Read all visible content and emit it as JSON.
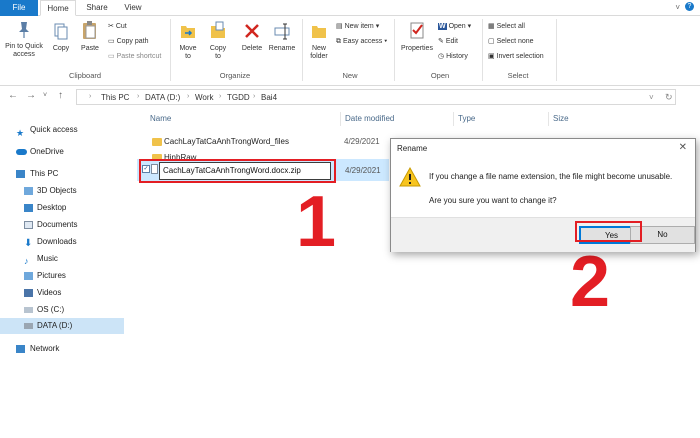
{
  "tabs": [
    "File",
    "Home",
    "Share",
    "View"
  ],
  "ribbon": {
    "clipboard": {
      "pin_label": "Pin to Quick access",
      "copy_label": "Copy",
      "paste_label": "Paste",
      "cut_label": "Cut",
      "copy_path_label": "Copy path",
      "paste_shortcut_label": "Paste shortcut",
      "group_label": "Clipboard"
    },
    "organize": {
      "move_to_label": "Move to",
      "copy_to_label": "Copy to",
      "delete_label": "Delete",
      "rename_label": "Rename",
      "group_label": "Organize"
    },
    "new": {
      "new_folder_label": "New folder",
      "new_item_label": "New item",
      "easy_access_label": "Easy access",
      "group_label": "New"
    },
    "open": {
      "properties_label": "Properties",
      "open_label": "Open",
      "edit_label": "Edit",
      "history_label": "History",
      "group_label": "Open"
    },
    "select": {
      "select_all_label": "Select all",
      "select_none_label": "Select none",
      "invert_selection_label": "Invert selection",
      "group_label": "Select"
    }
  },
  "address": {
    "crumbs": [
      "This PC",
      "DATA (D:)",
      "Work",
      "TGDD",
      "Bai4"
    ]
  },
  "nav": {
    "quick_access": "Quick access",
    "onedrive": "OneDrive",
    "this_pc": "This PC",
    "objects3d": "3D Objects",
    "desktop": "Desktop",
    "documents": "Documents",
    "downloads": "Downloads",
    "music": "Music",
    "pictures": "Pictures",
    "videos": "Videos",
    "os_c": "OS (C:)",
    "data_d": "DATA (D:)",
    "network": "Network"
  },
  "columns": {
    "name": "Name",
    "date_modified": "Date modified",
    "type": "Type",
    "size": "Size"
  },
  "files": [
    {
      "name": "CachLayTatCaAnhTrongWord_files",
      "date": "4/29/2021"
    },
    {
      "name": "HinhRaw",
      "date": ""
    },
    {
      "name": "CachLayTatCaAnhTrongWord.docx.zip",
      "date": "4/29/2021"
    }
  ],
  "rename_value": "CachLayTatCaAnhTrongWord.docx.zip",
  "step_numbers": [
    "1",
    "2"
  ],
  "dialog": {
    "title": "Rename",
    "message1": "If you change a file name extension, the file might become unusable.",
    "message2": "Are you sure you want to change it?",
    "yes_label": "Yes",
    "no_label": "No"
  },
  "colors": {
    "accent": "#1979ca",
    "highlight": "#e31e24",
    "selection": "#cce8ff"
  }
}
